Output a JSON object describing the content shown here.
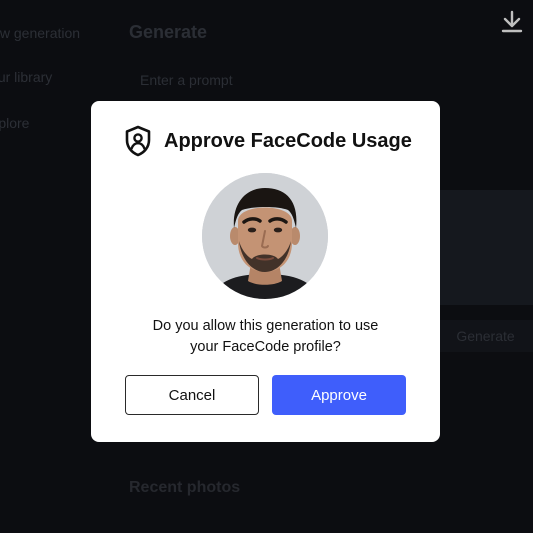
{
  "sidebar": {
    "items": [
      {
        "label": "New generation"
      },
      {
        "label": "Your library"
      },
      {
        "label": "Explore"
      }
    ]
  },
  "main": {
    "title": "Generate",
    "prompt_placeholder": "Enter a prompt",
    "generate_label": "Generate",
    "recent_title": "Recent photos"
  },
  "toolbar": {
    "download_icon": "download-icon"
  },
  "modal": {
    "title": "Approve FaceCode Usage",
    "icon": "shield-user-icon",
    "question_line1": "Do you allow this generation to use",
    "question_line2": "your FaceCode profile?",
    "cancel_label": "Cancel",
    "approve_label": "Approve",
    "colors": {
      "approve": "#3f5efb",
      "background": "#ffffff"
    }
  }
}
